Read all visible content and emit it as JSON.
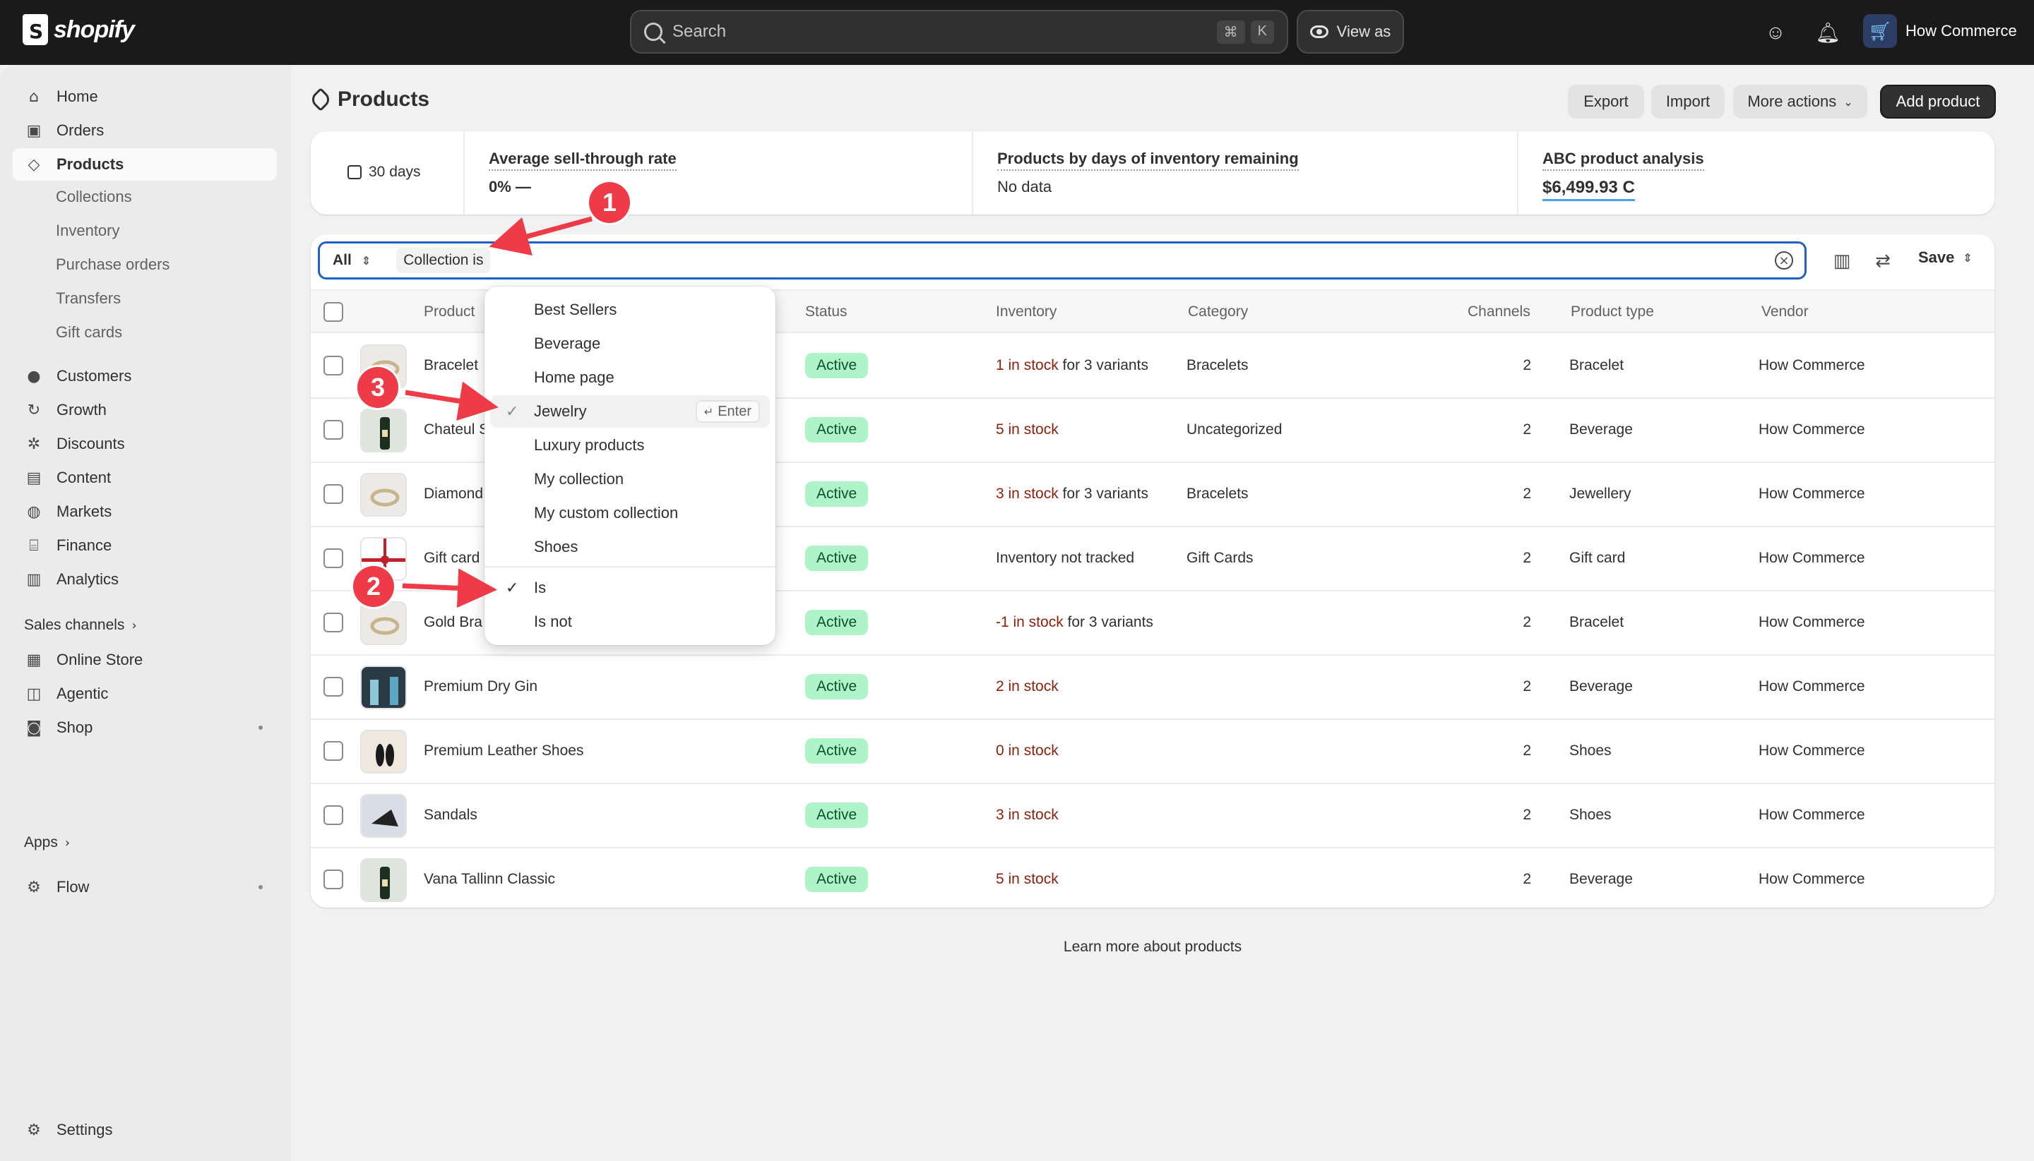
{
  "topbar": {
    "logo_text": "shopify",
    "search_placeholder": "Search",
    "shortcut_keys": [
      "⌘",
      "K"
    ],
    "view_as_label": "View as",
    "store_name": "How Commerce"
  },
  "sidebar": {
    "items": [
      {
        "label": "Home",
        "icon": "home-icon"
      },
      {
        "label": "Orders",
        "icon": "inbox-icon"
      },
      {
        "label": "Products",
        "icon": "tag-icon"
      }
    ],
    "product_sub": [
      "Collections",
      "Inventory",
      "Purchase orders",
      "Transfers",
      "Gift cards"
    ],
    "items2": [
      {
        "label": "Customers",
        "icon": "person-icon"
      },
      {
        "label": "Growth",
        "icon": "growth-icon"
      },
      {
        "label": "Discounts",
        "icon": "discount-icon"
      },
      {
        "label": "Content",
        "icon": "content-icon"
      },
      {
        "label": "Markets",
        "icon": "globe-icon"
      },
      {
        "label": "Finance",
        "icon": "bank-icon"
      },
      {
        "label": "Analytics",
        "icon": "bar-chart-icon"
      }
    ],
    "sales_channels_label": "Sales channels",
    "channels": [
      {
        "label": "Online Store",
        "icon": "store-icon"
      },
      {
        "label": "Agentic",
        "icon": "agentic-icon"
      },
      {
        "label": "Shop",
        "icon": "shop-icon"
      }
    ],
    "apps_label": "Apps",
    "apps": [
      {
        "label": "Flow",
        "icon": "flow-icon"
      }
    ],
    "settings_label": "Settings"
  },
  "page": {
    "title": "Products",
    "buttons": {
      "export": "Export",
      "import": "Import",
      "more_actions": "More actions",
      "add_product": "Add product"
    }
  },
  "stats": {
    "date_range": "30 days",
    "cards": [
      {
        "label": "Average sell-through rate",
        "value": "0%  —"
      },
      {
        "label": "Products by days of inventory remaining",
        "value": "No data"
      },
      {
        "label": "ABC product analysis",
        "value": "$6,499.93 C"
      }
    ]
  },
  "filter": {
    "view": "All",
    "chip": "Collection is",
    "save_label": "Save"
  },
  "table": {
    "headers": [
      "Product",
      "Status",
      "Inventory",
      "Category",
      "Channels",
      "Product type",
      "Vendor"
    ],
    "rows": [
      {
        "product": "Bracelet",
        "status": "Active",
        "stock": "1 in stock",
        "stock_suffix": " for 3 variants",
        "category": "Bracelets",
        "channels": "2",
        "type": "Bracelet",
        "vendor": "How Commerce",
        "thumb": "bracelet"
      },
      {
        "product": "Chateul S",
        "status": "Active",
        "stock": "5 in stock",
        "stock_suffix": "",
        "category": "Uncategorized",
        "channels": "2",
        "type": "Beverage",
        "vendor": "How Commerce",
        "thumb": "bottle"
      },
      {
        "product": "Diamond",
        "status": "Active",
        "stock": "3 in stock",
        "stock_suffix": " for 3 variants",
        "category": "Bracelets",
        "channels": "2",
        "type": "Jewellery",
        "vendor": "How Commerce",
        "thumb": "bracelet"
      },
      {
        "product": "Gift card",
        "status": "Active",
        "stock": "Inventory not tracked",
        "stock_suffix": "",
        "category": "Gift Cards",
        "channels": "2",
        "type": "Gift card",
        "vendor": "How Commerce",
        "thumb": "gift"
      },
      {
        "product": "Gold Bra",
        "status": "Active",
        "stock": "-1 in stock",
        "stock_suffix": " for 3 variants",
        "category": "",
        "channels": "2",
        "type": "Bracelet",
        "vendor": "How Commerce",
        "thumb": "bracelet"
      },
      {
        "product": "Premium Dry Gin",
        "status": "Active",
        "stock": "2 in stock",
        "stock_suffix": "",
        "category": "",
        "channels": "2",
        "type": "Beverage",
        "vendor": "How Commerce",
        "thumb": "gin"
      },
      {
        "product": "Premium Leather Shoes",
        "status": "Active",
        "stock": "0 in stock",
        "stock_suffix": "",
        "category": "",
        "channels": "2",
        "type": "Shoes",
        "vendor": "How Commerce",
        "thumb": "shoes"
      },
      {
        "product": "Sandals",
        "status": "Active",
        "stock": "3 in stock",
        "stock_suffix": "",
        "category": "",
        "channels": "2",
        "type": "Shoes",
        "vendor": "How Commerce",
        "thumb": "sandal"
      },
      {
        "product": "Vana Tallinn Classic",
        "status": "Active",
        "stock": "5 in stock",
        "stock_suffix": "",
        "category": "",
        "channels": "2",
        "type": "Beverage",
        "vendor": "How Commerce",
        "thumb": "bottle"
      }
    ],
    "learn_more": "Learn more about products"
  },
  "dropdown": {
    "collections": [
      "Best Sellers",
      "Beverage",
      "Home page",
      "Jewelry",
      "Luxury products",
      "My collection",
      "My custom collection",
      "Shoes"
    ],
    "selected_collection": "Jewelry",
    "enter_label": "Enter",
    "operators": [
      "Is",
      "Is not"
    ],
    "selected_operator": "Is"
  },
  "annotations": {
    "markers": [
      "1",
      "2",
      "3"
    ],
    "color": "#ef3b48"
  }
}
